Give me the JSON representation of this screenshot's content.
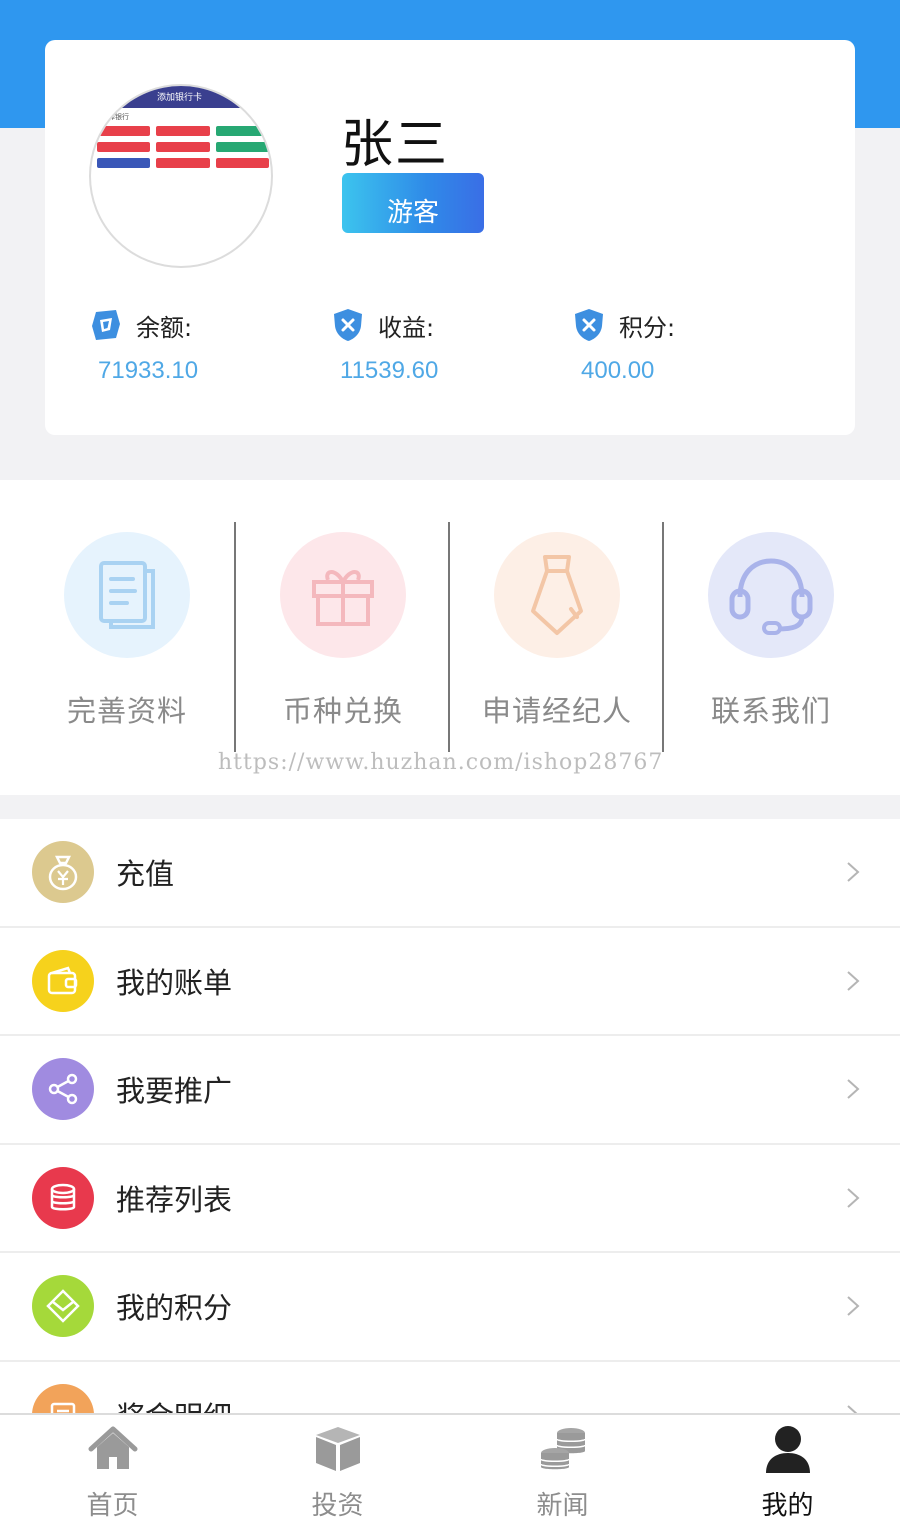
{
  "profile": {
    "name": "张三",
    "role": "游客",
    "avatar_caption": "添加银行卡",
    "avatar_tag": "选择银行"
  },
  "stats": [
    {
      "label": "余额:",
      "value": "71933.10",
      "icon": "balance-icon"
    },
    {
      "label": "收益:",
      "value": "11539.60",
      "icon": "shield-icon"
    },
    {
      "label": "积分:",
      "value": "400.00",
      "icon": "shield-icon"
    }
  ],
  "quick_actions": [
    {
      "label": "完善资料",
      "icon": "document-icon",
      "color": "#e6f3fd"
    },
    {
      "label": "币种兑换",
      "icon": "gift-icon",
      "color": "#fde7ea"
    },
    {
      "label": "申请经纪人",
      "icon": "tie-icon",
      "color": "#fdefe6"
    },
    {
      "label": "联系我们",
      "icon": "headset-icon",
      "color": "#e4e8f9"
    }
  ],
  "watermark": "https://www.huzhan.com/ishop28767",
  "menu": [
    {
      "label": "充值",
      "icon": "money-bag-icon",
      "color": "#dcc98f"
    },
    {
      "label": "我的账单",
      "icon": "wallet-icon",
      "color": "#f6d21c"
    },
    {
      "label": "我要推广",
      "icon": "share-icon",
      "color": "#a08be0"
    },
    {
      "label": "推荐列表",
      "icon": "database-icon",
      "color": "#e8394d"
    },
    {
      "label": "我的积分",
      "icon": "envelope-icon",
      "color": "#a5d93a"
    },
    {
      "label": "奖金明细",
      "icon": "list-icon",
      "color": "#f2a35a"
    }
  ],
  "tabs": [
    {
      "label": "首页",
      "icon": "home-icon",
      "active": false
    },
    {
      "label": "投资",
      "icon": "box-icon",
      "active": false
    },
    {
      "label": "新闻",
      "icon": "coins-icon",
      "active": false
    },
    {
      "label": "我的",
      "icon": "user-icon",
      "active": true
    }
  ]
}
